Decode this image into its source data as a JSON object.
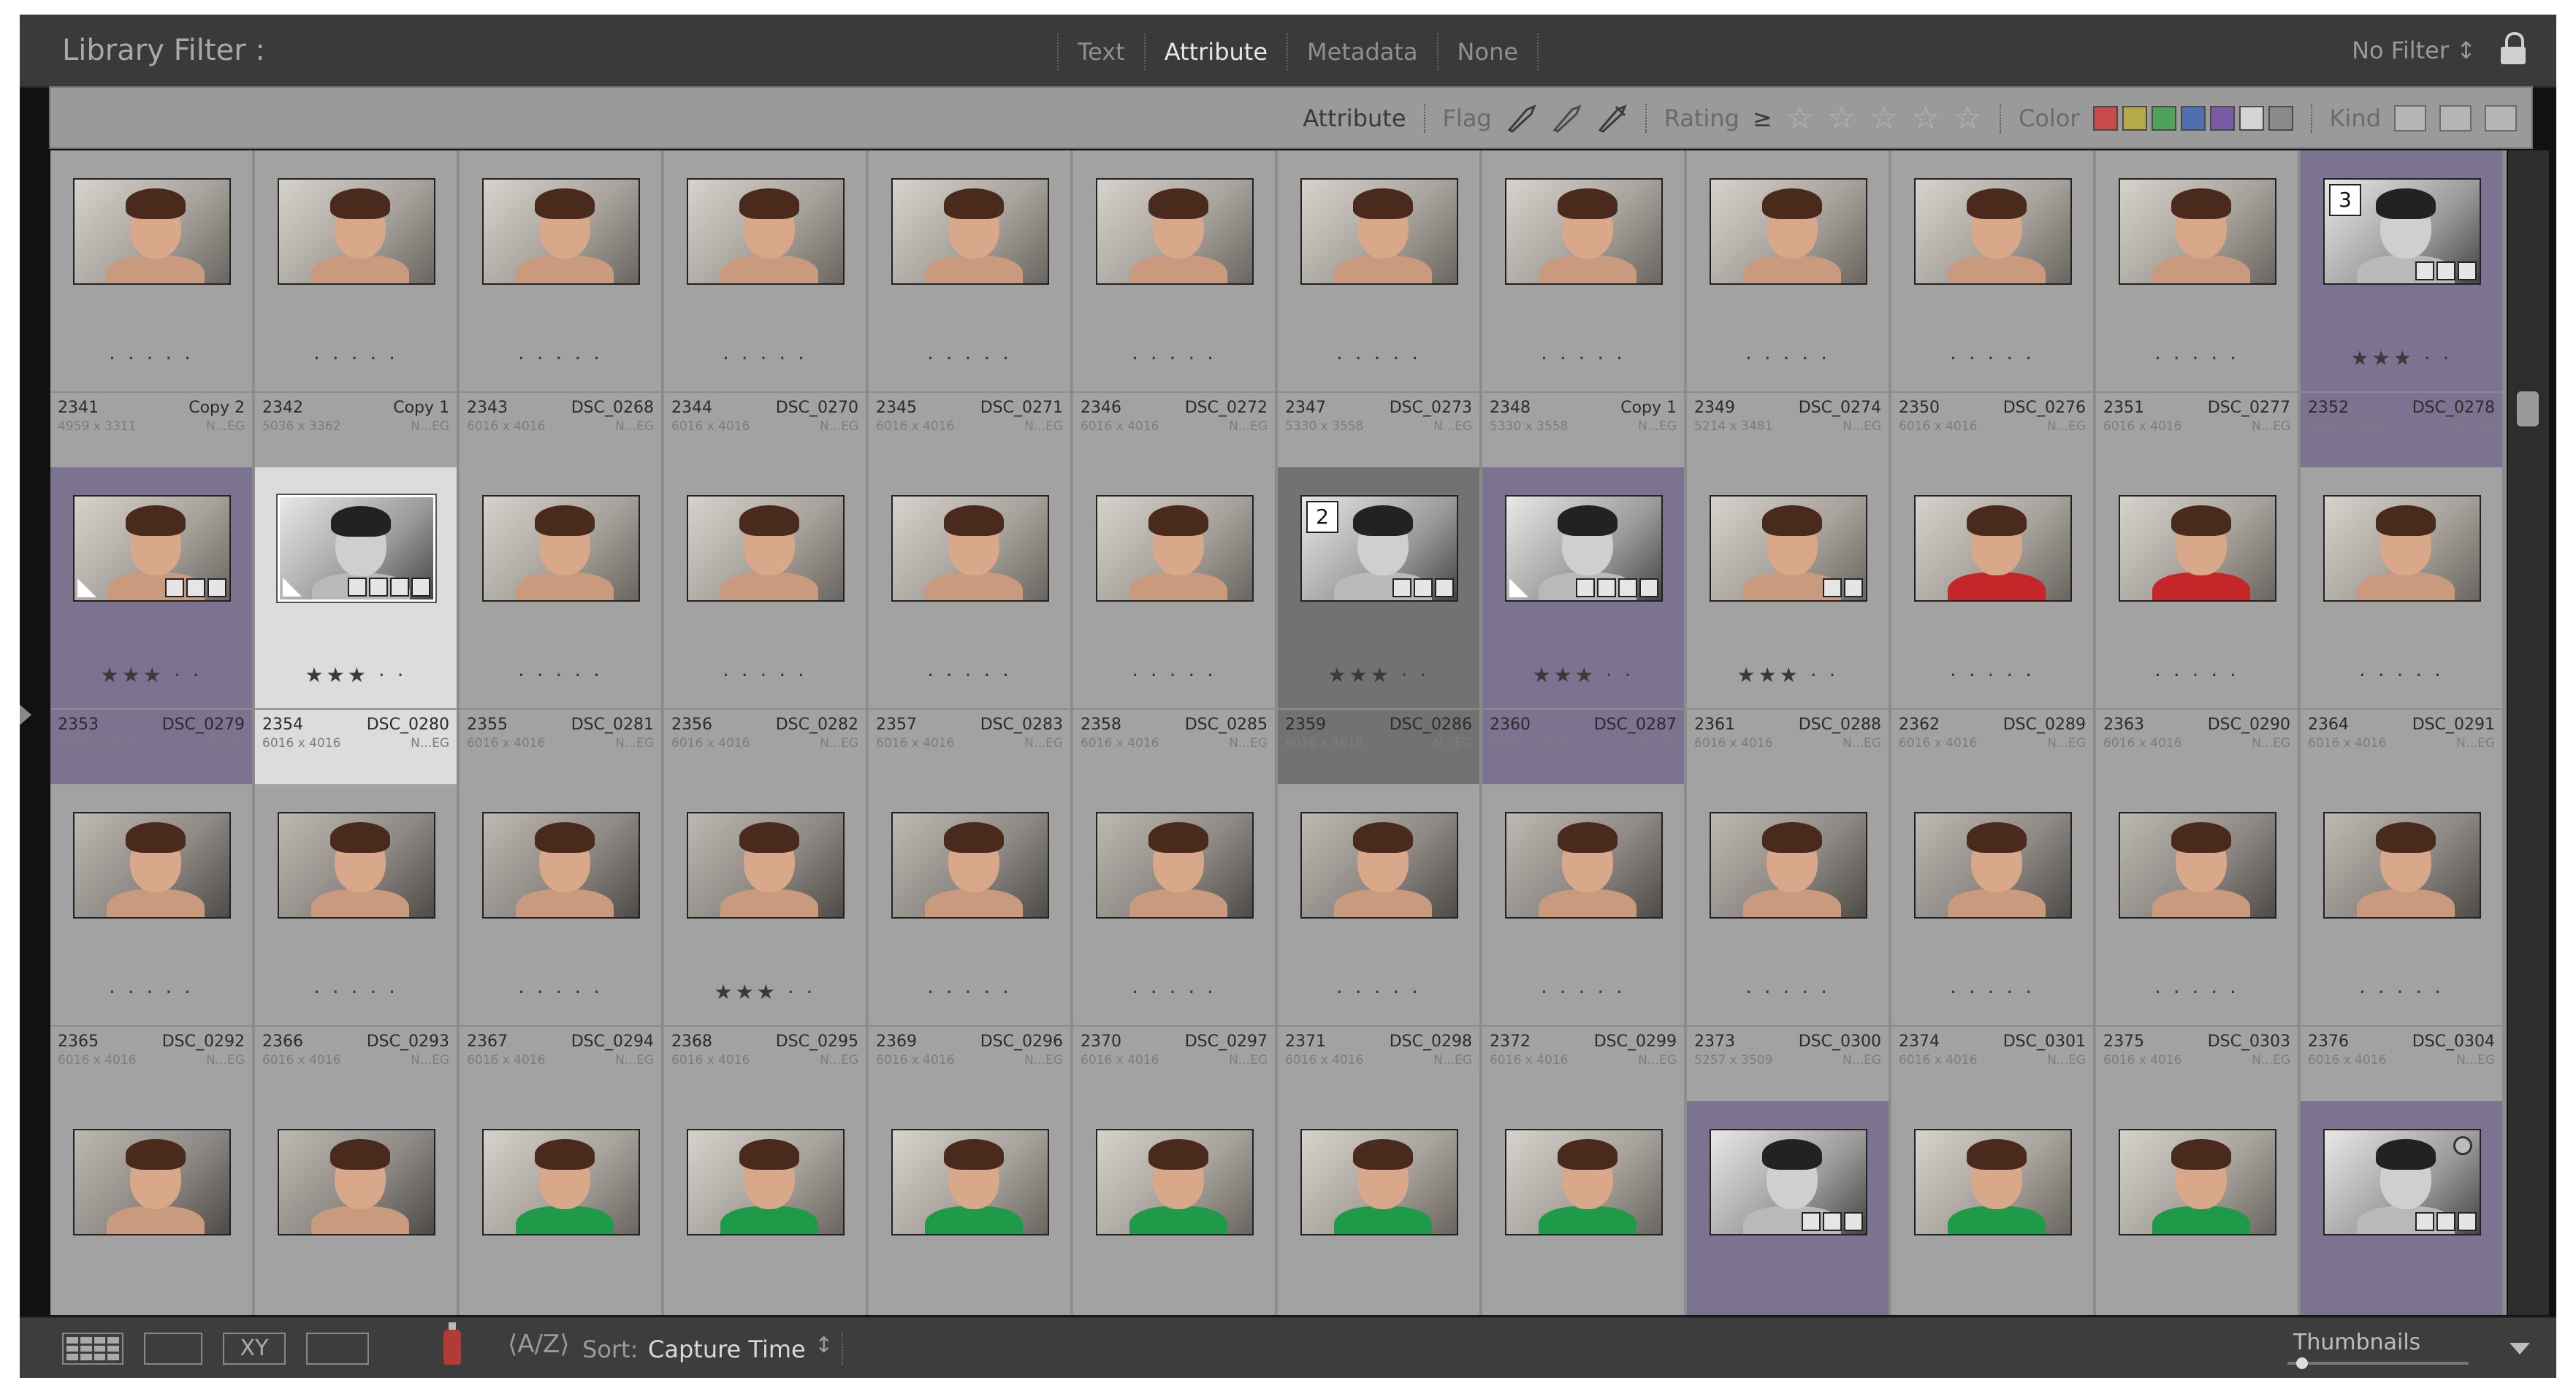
{
  "filter_bar": {
    "title": "Library Filter :",
    "tabs": [
      "Text",
      "Attribute",
      "Metadata",
      "None"
    ],
    "active_tab": "Attribute",
    "preset": "No Filter ↕"
  },
  "attribute_bar": {
    "label": "Attribute",
    "flag_label": "Flag",
    "rating_label": "Rating",
    "rating_op": "≥",
    "color_label": "Color",
    "kind_label": "Kind",
    "color_swatches": [
      "#c94a4a",
      "#b5a94a",
      "#4fa25a",
      "#4f6fb0",
      "#7b5aa6",
      "#d5d5d5",
      "#8a8a8a"
    ]
  },
  "grid": {
    "columns": 12,
    "cells": [
      {
        "idx": "2341",
        "name": "Copy 2",
        "dim": "4959 x 3311",
        "ext": "N...EG",
        "stars": "· · · · ·",
        "state": "normal",
        "tone": "normal",
        "torso": "skin"
      },
      {
        "idx": "2342",
        "name": "Copy 1",
        "dim": "5036 x 3362",
        "ext": "N...EG",
        "stars": "· · · · ·",
        "state": "normal",
        "tone": "normal",
        "torso": "skin"
      },
      {
        "idx": "2343",
        "name": "DSC_0268",
        "dim": "6016 x 4016",
        "ext": "N...EG",
        "stars": "· · · · ·",
        "state": "normal",
        "tone": "normal",
        "torso": "skin"
      },
      {
        "idx": "2344",
        "name": "DSC_0270",
        "dim": "6016 x 4016",
        "ext": "N...EG",
        "stars": "· · · · ·",
        "state": "normal",
        "tone": "normal",
        "torso": "skin"
      },
      {
        "idx": "2345",
        "name": "DSC_0271",
        "dim": "6016 x 4016",
        "ext": "N...EG",
        "stars": "· · · · ·",
        "state": "normal",
        "tone": "normal",
        "torso": "skin"
      },
      {
        "idx": "2346",
        "name": "DSC_0272",
        "dim": "6016 x 4016",
        "ext": "N...EG",
        "stars": "· · · · ·",
        "state": "normal",
        "tone": "normal",
        "torso": "skin"
      },
      {
        "idx": "2347",
        "name": "DSC_0273",
        "dim": "5330 x 3558",
        "ext": "N...EG",
        "stars": "· · · · ·",
        "state": "normal",
        "tone": "normal",
        "torso": "skin"
      },
      {
        "idx": "2348",
        "name": "Copy 1",
        "dim": "5330 x 3558",
        "ext": "N...EG",
        "stars": "· · · · ·",
        "state": "normal",
        "tone": "normal",
        "torso": "skin"
      },
      {
        "idx": "2349",
        "name": "DSC_0274",
        "dim": "5214 x 3481",
        "ext": "N...EG",
        "stars": "· · · · ·",
        "state": "normal",
        "tone": "normal",
        "torso": "skin"
      },
      {
        "idx": "2350",
        "name": "DSC_0276",
        "dim": "6016 x 4016",
        "ext": "N...EG",
        "stars": "· · · · ·",
        "state": "normal",
        "tone": "normal",
        "torso": "skin"
      },
      {
        "idx": "2351",
        "name": "DSC_0277",
        "dim": "6016 x 4016",
        "ext": "N...EG",
        "stars": "· · · · ·",
        "state": "normal",
        "tone": "normal",
        "torso": "skin",
        "dots": "•••"
      },
      {
        "idx": "2352",
        "name": "DSC_0278",
        "dim": "6016 x 4016",
        "ext": "N...EG",
        "stars": "★★★ · ·",
        "state": "sel",
        "tone": "bw",
        "torso": "bw",
        "num": "3",
        "badges": 3
      },
      {
        "idx": "2353",
        "name": "DSC_0279",
        "dim": "6016 x 4016",
        "ext": "N...EG",
        "stars": "★★★ · ·",
        "state": "sel",
        "tone": "normal",
        "torso": "skin",
        "badges": 3,
        "corner": true,
        "dots": "•••"
      },
      {
        "idx": "2354",
        "name": "DSC_0280",
        "dim": "6016 x 4016",
        "ext": "N...EG",
        "stars": "★★★ · ·",
        "state": "primary",
        "tone": "bw",
        "torso": "bw",
        "badges": 4,
        "corner": true,
        "white": true,
        "dots": "•••"
      },
      {
        "idx": "2355",
        "name": "DSC_0281",
        "dim": "6016 x 4016",
        "ext": "N...EG",
        "stars": "· · · · ·",
        "state": "normal",
        "tone": "normal",
        "torso": "skin",
        "dots": "•••"
      },
      {
        "idx": "2356",
        "name": "DSC_0282",
        "dim": "6016 x 4016",
        "ext": "N...EG",
        "stars": "· · · · ·",
        "state": "normal",
        "tone": "normal",
        "torso": "skin"
      },
      {
        "idx": "2357",
        "name": "DSC_0283",
        "dim": "6016 x 4016",
        "ext": "N...EG",
        "stars": "· · · · ·",
        "state": "normal",
        "tone": "normal",
        "torso": "skin",
        "dots": "•••"
      },
      {
        "idx": "2358",
        "name": "DSC_0285",
        "dim": "6016 x 4016",
        "ext": "N...EG",
        "stars": "· · · · ·",
        "state": "normal",
        "tone": "normal",
        "torso": "skin",
        "dots": "•••"
      },
      {
        "idx": "2359",
        "name": "DSC_0286",
        "dim": "6016 x 4016",
        "ext": "N...EG",
        "stars": "★★★ · ·",
        "state": "dark",
        "tone": "bw",
        "torso": "bw",
        "num": "2",
        "badges": 3
      },
      {
        "idx": "2360",
        "name": "DSC_0287",
        "dim": "6016 x 4016",
        "ext": "N...EG",
        "stars": "★★★ · ·",
        "state": "sel",
        "tone": "bw",
        "torso": "bw",
        "badges": 4,
        "corner": true
      },
      {
        "idx": "2361",
        "name": "DSC_0288",
        "dim": "6016 x 4016",
        "ext": "N...EG",
        "stars": "★★★ · ·",
        "state": "normal",
        "tone": "normal",
        "torso": "skin",
        "badges": 2
      },
      {
        "idx": "2362",
        "name": "DSC_0289",
        "dim": "6016 x 4016",
        "ext": "N...EG",
        "stars": "· · · · ·",
        "state": "normal",
        "tone": "normal",
        "torso": "red"
      },
      {
        "idx": "2363",
        "name": "DSC_0290",
        "dim": "6016 x 4016",
        "ext": "N...EG",
        "stars": "· · · · ·",
        "state": "normal",
        "tone": "normal",
        "torso": "red"
      },
      {
        "idx": "2364",
        "name": "DSC_0291",
        "dim": "6016 x 4016",
        "ext": "N...EG",
        "stars": "· · · · ·",
        "state": "normal",
        "tone": "normal",
        "torso": "skin"
      },
      {
        "idx": "2365",
        "name": "DSC_0292",
        "dim": "6016 x 4016",
        "ext": "N...EG",
        "stars": "· · · · ·",
        "state": "normal",
        "tone": "dk",
        "torso": "skin"
      },
      {
        "idx": "2366",
        "name": "DSC_0293",
        "dim": "6016 x 4016",
        "ext": "N...EG",
        "stars": "· · · · ·",
        "state": "normal",
        "tone": "dk",
        "torso": "skin"
      },
      {
        "idx": "2367",
        "name": "DSC_0294",
        "dim": "6016 x 4016",
        "ext": "N...EG",
        "stars": "· · · · ·",
        "state": "normal",
        "tone": "dk",
        "torso": "skin"
      },
      {
        "idx": "2368",
        "name": "DSC_0295",
        "dim": "6016 x 4016",
        "ext": "N...EG",
        "stars": "★★★ · ·",
        "state": "normal",
        "tone": "dk",
        "torso": "skin"
      },
      {
        "idx": "2369",
        "name": "DSC_0296",
        "dim": "6016 x 4016",
        "ext": "N...EG",
        "stars": "· · · · ·",
        "state": "normal",
        "tone": "dk",
        "torso": "skin"
      },
      {
        "idx": "2370",
        "name": "DSC_0297",
        "dim": "6016 x 4016",
        "ext": "N...EG",
        "stars": "· · · · ·",
        "state": "normal",
        "tone": "dk",
        "torso": "skin"
      },
      {
        "idx": "2371",
        "name": "DSC_0298",
        "dim": "6016 x 4016",
        "ext": "N...EG",
        "stars": "· · · · ·",
        "state": "normal",
        "tone": "dk",
        "torso": "skin"
      },
      {
        "idx": "2372",
        "name": "DSC_0299",
        "dim": "6016 x 4016",
        "ext": "N...EG",
        "stars": "· · · · ·",
        "state": "normal",
        "tone": "dk",
        "torso": "skin"
      },
      {
        "idx": "2373",
        "name": "DSC_0300",
        "dim": "5257 x 3509",
        "ext": "N...EG",
        "stars": "· · · · ·",
        "state": "normal",
        "tone": "dk",
        "torso": "skin"
      },
      {
        "idx": "2374",
        "name": "DSC_0301",
        "dim": "6016 x 4016",
        "ext": "N...EG",
        "stars": "· · · · ·",
        "state": "normal",
        "tone": "dk",
        "torso": "skin"
      },
      {
        "idx": "2375",
        "name": "DSC_0303",
        "dim": "6016 x 4016",
        "ext": "N...EG",
        "stars": "· · · · ·",
        "state": "normal",
        "tone": "dk",
        "torso": "skin"
      },
      {
        "idx": "2376",
        "name": "DSC_0304",
        "dim": "6016 x 4016",
        "ext": "N...EG",
        "stars": "· · · · ·",
        "state": "normal",
        "tone": "dk",
        "torso": "skin"
      },
      {
        "idx": "",
        "name": "",
        "dim": "",
        "ext": "",
        "stars": "",
        "state": "normal",
        "tone": "dk",
        "torso": "skin"
      },
      {
        "idx": "",
        "name": "",
        "dim": "",
        "ext": "",
        "stars": "",
        "state": "normal",
        "tone": "dk",
        "torso": "skin"
      },
      {
        "idx": "",
        "name": "",
        "dim": "",
        "ext": "",
        "stars": "",
        "state": "normal",
        "tone": "normal",
        "torso": "green"
      },
      {
        "idx": "",
        "name": "",
        "dim": "",
        "ext": "",
        "stars": "",
        "state": "normal",
        "tone": "normal",
        "torso": "green"
      },
      {
        "idx": "",
        "name": "",
        "dim": "",
        "ext": "",
        "stars": "",
        "state": "normal",
        "tone": "normal",
        "torso": "green"
      },
      {
        "idx": "",
        "name": "",
        "dim": "",
        "ext": "",
        "stars": "",
        "state": "normal",
        "tone": "normal",
        "torso": "green"
      },
      {
        "idx": "",
        "name": "",
        "dim": "",
        "ext": "",
        "stars": "",
        "state": "normal",
        "tone": "normal",
        "torso": "green"
      },
      {
        "idx": "",
        "name": "",
        "dim": "",
        "ext": "",
        "stars": "",
        "state": "normal",
        "tone": "normal",
        "torso": "green"
      },
      {
        "idx": "",
        "name": "",
        "dim": "",
        "ext": "",
        "stars": "",
        "state": "sel",
        "tone": "bw",
        "torso": "bw",
        "badges": 3
      },
      {
        "idx": "",
        "name": "",
        "dim": "",
        "ext": "",
        "stars": "",
        "state": "normal",
        "tone": "normal",
        "torso": "green"
      },
      {
        "idx": "",
        "name": "",
        "dim": "",
        "ext": "",
        "stars": "",
        "state": "normal",
        "tone": "normal",
        "torso": "green"
      },
      {
        "idx": "",
        "name": "",
        "dim": "",
        "ext": "",
        "stars": "",
        "state": "sel",
        "tone": "bw",
        "torso": "bw",
        "badges": 3,
        "circle": true
      }
    ]
  },
  "toolbar": {
    "sort_label": "Sort:",
    "sort_value": "Capture Time",
    "sort_arrow": "↕",
    "thumbnails_label": "Thumbnails",
    "thumbnail_size": 0.05,
    "view_icons": [
      "grid-view-icon",
      "loupe-view-icon",
      "compare-view-icon",
      "survey-view-icon"
    ]
  }
}
